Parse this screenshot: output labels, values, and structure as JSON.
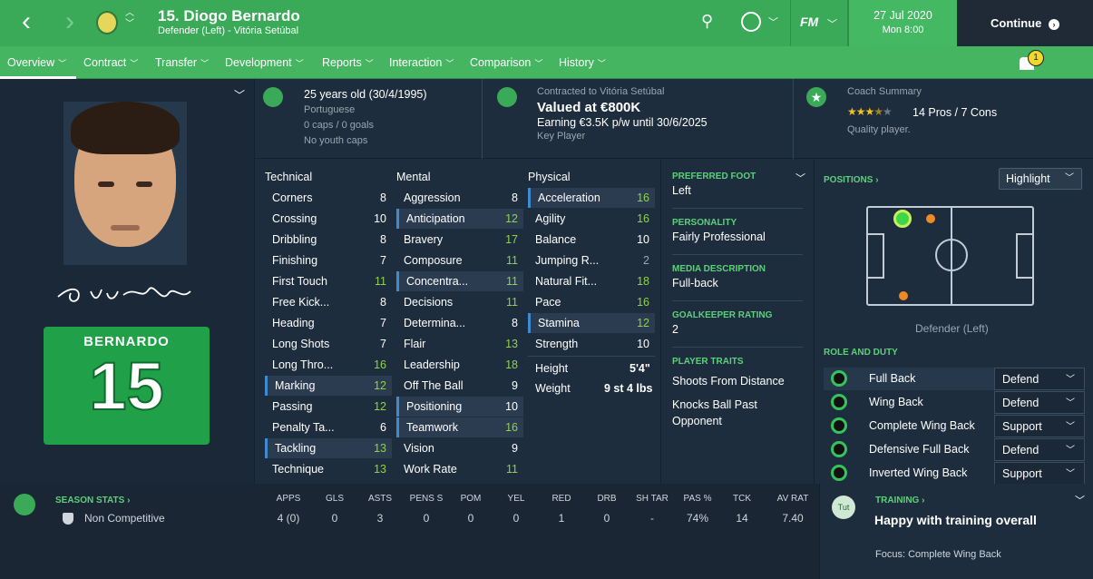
{
  "header": {
    "player_title": "15. Diogo Bernardo",
    "subtitle": "Defender (Left) - Vitória Setúbal",
    "date": "27 Jul 2020",
    "day_time": "Mon 8:00",
    "continue_label": "Continue",
    "fm_label": "FM"
  },
  "nav": {
    "items": [
      "Overview",
      "Contract",
      "Transfer",
      "Development",
      "Reports",
      "Interaction",
      "Comparison",
      "History"
    ],
    "notification_count": "1"
  },
  "bio": {
    "age": "25 years old (30/4/1995)",
    "nationality": "Portuguese",
    "caps": "0 caps / 0 goals",
    "youth": "No youth caps"
  },
  "contract": {
    "label": "Contracted to Vitória Setúbal",
    "value": "Valued at €800K",
    "earning": "Earning €3.5K p/w until 30/6/2025",
    "status": "Key Player"
  },
  "coach": {
    "label": "Coach Summary",
    "stars": 3.5,
    "pros_cons": "14 Pros / 7 Cons",
    "quality": "Quality player."
  },
  "shirt": {
    "name": "BERNARDO",
    "number": "15"
  },
  "signature": "Diogo Bernardo",
  "attributes": {
    "technical_header": "Technical",
    "mental_header": "Mental",
    "physical_header": "Physical",
    "technical": [
      {
        "name": "Corners",
        "value": "8"
      },
      {
        "name": "Crossing",
        "value": "10"
      },
      {
        "name": "Dribbling",
        "value": "8"
      },
      {
        "name": "Finishing",
        "value": "7"
      },
      {
        "name": "First Touch",
        "value": "11"
      },
      {
        "name": "Free Kick...",
        "value": "8"
      },
      {
        "name": "Heading",
        "value": "7"
      },
      {
        "name": "Long Shots",
        "value": "7"
      },
      {
        "name": "Long Thro...",
        "value": "16"
      },
      {
        "name": "Marking",
        "value": "12"
      },
      {
        "name": "Passing",
        "value": "12"
      },
      {
        "name": "Penalty Ta...",
        "value": "6"
      },
      {
        "name": "Tackling",
        "value": "13"
      },
      {
        "name": "Technique",
        "value": "13"
      }
    ],
    "mental": [
      {
        "name": "Aggression",
        "value": "8"
      },
      {
        "name": "Anticipation",
        "value": "12"
      },
      {
        "name": "Bravery",
        "value": "17"
      },
      {
        "name": "Composure",
        "value": "11"
      },
      {
        "name": "Concentra...",
        "value": "11"
      },
      {
        "name": "Decisions",
        "value": "11"
      },
      {
        "name": "Determina...",
        "value": "8"
      },
      {
        "name": "Flair",
        "value": "13"
      },
      {
        "name": "Leadership",
        "value": "18"
      },
      {
        "name": "Off The Ball",
        "value": "9"
      },
      {
        "name": "Positioning",
        "value": "10"
      },
      {
        "name": "Teamwork",
        "value": "16"
      },
      {
        "name": "Vision",
        "value": "9"
      },
      {
        "name": "Work Rate",
        "value": "11"
      }
    ],
    "physical": [
      {
        "name": "Acceleration",
        "value": "16"
      },
      {
        "name": "Agility",
        "value": "16"
      },
      {
        "name": "Balance",
        "value": "10"
      },
      {
        "name": "Jumping R...",
        "value": "2"
      },
      {
        "name": "Natural Fit...",
        "value": "18"
      },
      {
        "name": "Pace",
        "value": "16"
      },
      {
        "name": "Stamina",
        "value": "12"
      },
      {
        "name": "Strength",
        "value": "10"
      }
    ],
    "height_label": "Height",
    "height": "5'4\"",
    "weight_label": "Weight",
    "weight": "9 st 4 lbs"
  },
  "details": {
    "preferred_foot_label": "PREFERRED FOOT",
    "preferred_foot": "Left",
    "personality_label": "PERSONALITY",
    "personality": "Fairly Professional",
    "media_label": "MEDIA DESCRIPTION",
    "media": "Full-back",
    "gk_label": "GOALKEEPER RATING",
    "gk": "2",
    "traits_label": "PLAYER TRAITS",
    "trait1": "Shoots From Distance",
    "trait2": "Knocks Ball Past Opponent"
  },
  "positions": {
    "label": "POSITIONS",
    "highlight": "Highlight",
    "position_name": "Defender (Left)",
    "role_label": "ROLE AND DUTY",
    "roles": [
      {
        "role": "Full Back",
        "duty": "Defend"
      },
      {
        "role": "Wing Back",
        "duty": "Defend"
      },
      {
        "role": "Complete Wing Back",
        "duty": "Support"
      },
      {
        "role": "Defensive Full Back",
        "duty": "Defend"
      },
      {
        "role": "Inverted Wing Back",
        "duty": "Support"
      }
    ]
  },
  "season_stats": {
    "label": "SEASON STATS",
    "competition": "Non Competitive",
    "headers": [
      "APPS",
      "GLS",
      "ASTS",
      "PENS S",
      "POM",
      "YEL",
      "RED",
      "DRB",
      "SH TAR",
      "PAS %",
      "TCK",
      "AV RAT"
    ],
    "values": [
      "4 (0)",
      "0",
      "3",
      "0",
      "0",
      "0",
      "1",
      "0",
      "-",
      "74%",
      "14",
      "7.40"
    ]
  },
  "training": {
    "label": "TRAINING",
    "badge": "Tut",
    "status": "Happy with training overall",
    "focus_label": "Focus:",
    "focus": "Complete Wing Back"
  },
  "colors": {
    "accent": "#3aaa58",
    "highlight_bar": "#3f8ad1",
    "good_value": "#8fd14f"
  }
}
